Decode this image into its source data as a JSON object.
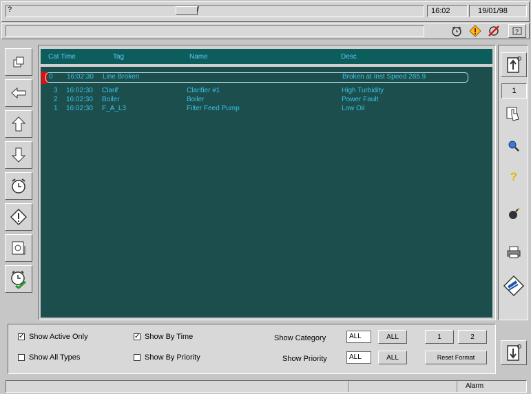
{
  "top": {
    "title_prefix": "?",
    "title_text": "/",
    "clock": "16:02",
    "date": "19/01/98"
  },
  "right_toolbar": {
    "page_number": "1"
  },
  "grid": {
    "columns": [
      "Cat",
      "Time",
      "Tag",
      "Name",
      "Desc"
    ],
    "rows": [
      {
        "cat": "0",
        "time": "16:02:30",
        "tag": "Line Broken",
        "name": "",
        "desc": "Broken at Inst Speed 285.9",
        "selected": true
      },
      {
        "cat": "3",
        "time": "16:02:30",
        "tag": "Clarif",
        "name": "Clarifier #1",
        "desc": "High Turbidity",
        "selected": false
      },
      {
        "cat": "2",
        "time": "16:02:30",
        "tag": "Boiler",
        "name": "Boiler",
        "desc": "Power Fault",
        "selected": false
      },
      {
        "cat": "1",
        "time": "16:02:30",
        "tag": "F_A_L3",
        "name": "Filter Feed Pump",
        "desc": "Low Oil",
        "selected": false
      }
    ]
  },
  "controls": {
    "show_active_only": "Show Active Only",
    "show_all_types": "Show All Types",
    "show_by_time": "Show By Time",
    "show_by_priority": "Show By Priority",
    "show_category_label": "Show Category",
    "show_priority_label": "Show Priority",
    "category_value": "ALL",
    "priority_value": "ALL",
    "all_button": "ALL",
    "page1_button": "1",
    "page2_button": "2",
    "reset_format": "Reset Format",
    "checked": {
      "show_active_only": true,
      "show_all_types": false,
      "show_by_time": true,
      "show_by_priority": false
    }
  },
  "status": {
    "right_text": "Alarm"
  },
  "colors": {
    "grid_bg": "#1c4e4e",
    "grid_text": "#3bc3e6",
    "header_bg": "#0d5d5d"
  }
}
